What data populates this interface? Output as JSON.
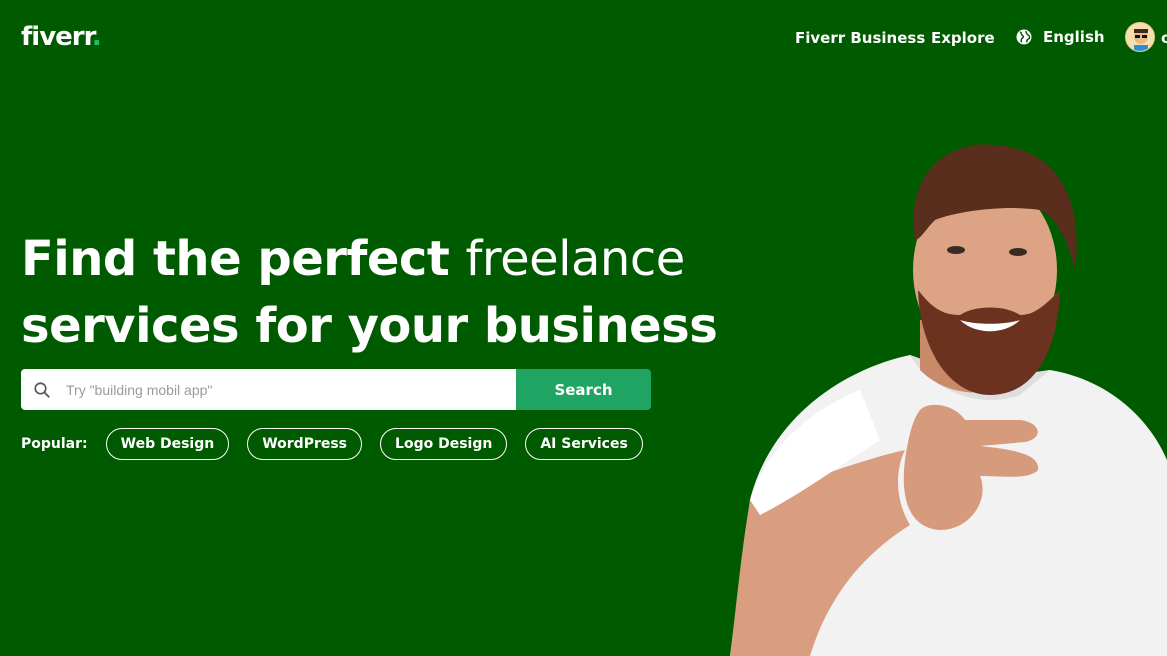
{
  "header": {
    "logo_text": "fiverr",
    "logo_dot": ".",
    "nav": {
      "business": "Fiverr Business",
      "explore": "Explore",
      "language": "English"
    },
    "user_initial": "c"
  },
  "hero": {
    "title_bold_1": "Find the perfect",
    "title_light": "freelance",
    "title_bold_2": "services for your business",
    "search": {
      "placeholder": "Try \"building mobil app\"",
      "value": "",
      "button_label": "Search"
    },
    "popular": {
      "label": "Popular:",
      "tags": [
        "Web Design",
        "WordPress",
        "Logo Design",
        "AI Services"
      ]
    }
  },
  "colors": {
    "background": "#005a00",
    "accent": "#1dbf73",
    "search_button": "#1fa463"
  },
  "icons": {
    "search": "search-icon",
    "globe": "globe-icon"
  }
}
